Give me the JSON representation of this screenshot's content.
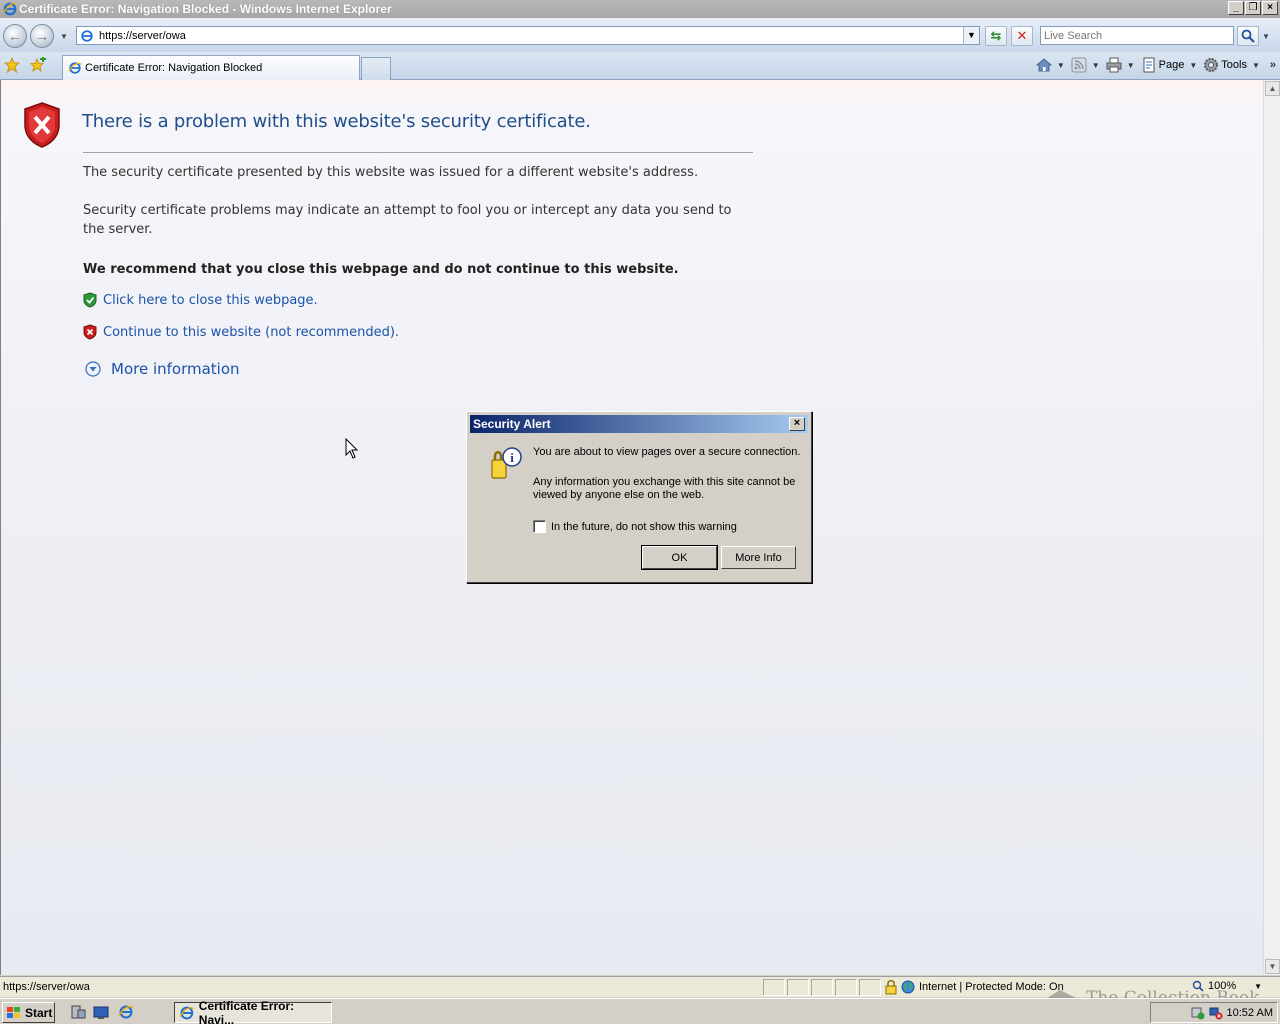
{
  "window": {
    "title": "Certificate Error: Navigation Blocked - Windows Internet Explorer",
    "controls": [
      "_",
      "❐",
      "×"
    ]
  },
  "address_bar": {
    "url": "https://server/owa"
  },
  "search": {
    "placeholder": "Live Search"
  },
  "tab": {
    "label": "Certificate Error: Navigation Blocked"
  },
  "command_bar": {
    "page_label": "Page",
    "tools_label": "Tools"
  },
  "page": {
    "heading": "There is a problem with this website's security certificate.",
    "para1": "The security certificate presented by this website was issued for a different website's address.",
    "para2": "Security certificate problems may indicate an attempt to fool you or intercept any data you send to the server.",
    "recommend": "We recommend that you close this webpage and do not continue to this website.",
    "close_link": "Click here to close this webpage.",
    "continue_link": "Continue to this website (not recommended).",
    "more_info": "More information"
  },
  "dialog": {
    "title": "Security Alert",
    "text1": "You are about to view pages over a secure connection.",
    "text2": "Any information you exchange with this site cannot be viewed by anyone else on the web.",
    "checkbox_label": "In the future, do not show this warning",
    "checkbox_checked": false,
    "ok_label": "OK",
    "more_info_label": "More Info"
  },
  "status_bar": {
    "url": "https://server/owa",
    "zone": "Internet | Protected Mode: On",
    "zoom": "100%"
  },
  "watermark": {
    "text": "The Collection Book"
  },
  "taskbar": {
    "start_label": "Start",
    "task_label": "Certificate Error: Navi...",
    "clock": "10:52 AM"
  },
  "icons": {
    "error_shield": "red-shield-x-icon",
    "close_shield": "green-shield-check-icon",
    "continue_shield": "red-shield-x-icon",
    "more_info": "chevron-down-circle-icon",
    "dialog_icon": "padlock-info-icon"
  }
}
